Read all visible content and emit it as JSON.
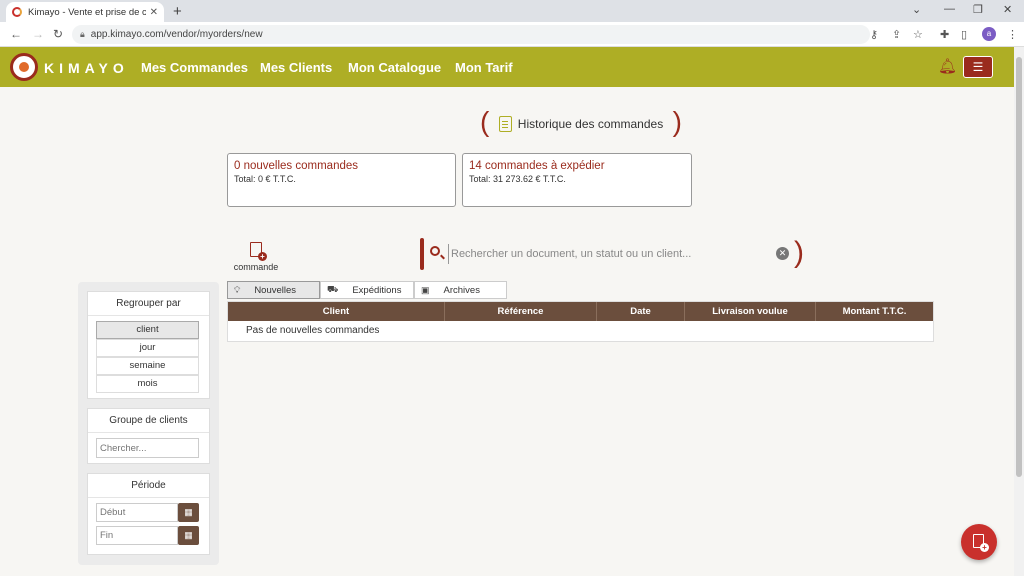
{
  "browser": {
    "tab_title": "Kimayo - Vente et prise de comm",
    "url": "app.kimayo.com/vendor/myorders/new",
    "profile_initial": "a"
  },
  "header": {
    "logo_text": "KIMAYO",
    "nav": [
      "Mes Commandes",
      "Mes Clients",
      "Mon Catalogue",
      "Mon Tarif"
    ]
  },
  "page": {
    "title": "Historique des commandes"
  },
  "cards": [
    {
      "title": "0 nouvelles commandes",
      "subtitle": "Total: 0 € T.T.C."
    },
    {
      "title": "14 commandes à expédier",
      "subtitle": "Total: 31 273.62 € T.T.C."
    }
  ],
  "new_order": {
    "label": "commande"
  },
  "search": {
    "placeholder": "Rechercher un document, un statut ou un client..."
  },
  "sidebar": {
    "group_by": {
      "title": "Regrouper par",
      "options": [
        "client",
        "jour",
        "semaine",
        "mois"
      ],
      "selected": "client"
    },
    "client_group": {
      "title": "Groupe de clients",
      "placeholder": "Chercher..."
    },
    "period": {
      "title": "Période",
      "start_placeholder": "Début",
      "end_placeholder": "Fin"
    }
  },
  "tabs": [
    {
      "label": "Nouvelles",
      "icon": "lightbulb-icon",
      "active": true
    },
    {
      "label": "Expéditions",
      "icon": "truck-icon",
      "active": false
    },
    {
      "label": "Archives",
      "icon": "archive-icon",
      "active": false
    }
  ],
  "table": {
    "columns": [
      "Client",
      "Référence",
      "Date",
      "Livraison voulue",
      "Montant T.T.C."
    ],
    "empty_message": "Pas de nouvelles commandes"
  },
  "colors": {
    "brand_green": "#aeae25",
    "brand_red": "#9a2b1d",
    "table_header": "#6b4e3d",
    "fab": "#c9302c"
  }
}
